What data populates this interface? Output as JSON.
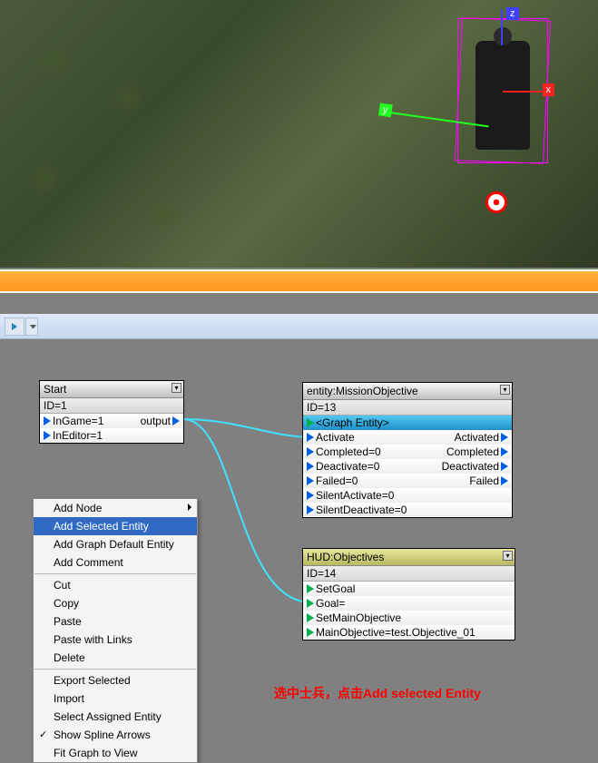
{
  "viewport": {
    "axes": {
      "x": "x",
      "y": "y",
      "z": "z"
    }
  },
  "nodes": {
    "start": {
      "title": "Start",
      "id_line": "ID=1",
      "rows": {
        "ingame": "InGame=1",
        "output": "output",
        "ineditor": "InEditor=1"
      }
    },
    "mission": {
      "title": "entity:MissionObjective",
      "id_line": "ID=13",
      "entity_row": "<Graph Entity>",
      "rows": {
        "activate_in": "Activate",
        "activated_out": "Activated",
        "completed_in": "Completed=0",
        "completed_out": "Completed",
        "deactivate_in": "Deactivate=0",
        "deactivated_out": "Deactivated",
        "failed_in": "Failed=0",
        "failed_out": "Failed",
        "silentactivate": "SilentActivate=0",
        "silentdeactivate": "SilentDeactivate=0"
      }
    },
    "hud": {
      "title": "HUD:Objectives",
      "id_line": "ID=14",
      "rows": {
        "setgoal": "SetGoal",
        "goal": "Goal=",
        "setmain": "SetMainObjective",
        "mainobj": "MainObjective=test.Objective_01"
      }
    }
  },
  "context_menu": {
    "add_node": "Add Node",
    "add_selected_entity": "Add Selected Entity",
    "add_graph_default": "Add Graph Default Entity",
    "add_comment": "Add Comment",
    "cut": "Cut",
    "copy": "Copy",
    "paste": "Paste",
    "paste_links": "Paste with Links",
    "delete": "Delete",
    "export_selected": "Export Selected",
    "import": "Import",
    "select_assigned": "Select Assigned Entity",
    "show_spline": "Show Spline Arrows",
    "fit_graph": "Fit Graph to View"
  },
  "annotation": "选中士兵，点击Add selected Entity"
}
